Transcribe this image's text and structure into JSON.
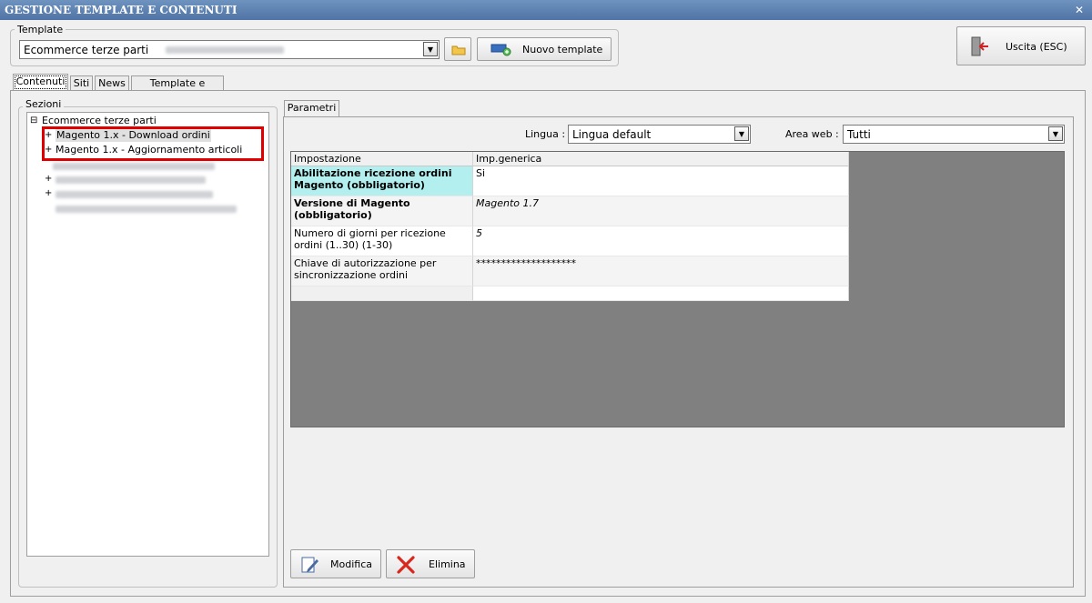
{
  "window": {
    "title": "GESTIONE TEMPLATE E CONTENUTI"
  },
  "template_group": {
    "label": "Template",
    "selected": "Ecommerce terze parti",
    "new_button": "Nuovo template"
  },
  "exit_button": {
    "label": "Uscita (ESC)"
  },
  "tabs": [
    {
      "label": "Contenuti"
    },
    {
      "label": "Siti"
    },
    {
      "label": "News"
    },
    {
      "label": "Template e plugins"
    }
  ],
  "sections": {
    "label": "Sezioni",
    "root": "Ecommerce terze parti",
    "items": [
      {
        "label": "Magento 1.x - Download ordini"
      },
      {
        "label": "Magento 1.x - Aggiornamento articoli"
      }
    ]
  },
  "params": {
    "tab": "Parametri",
    "lingua_label": "Lingua :",
    "lingua_value": "Lingua default",
    "area_label": "Area web :",
    "area_value": "Tutti",
    "headers": [
      "Impostazione",
      "Imp.generica"
    ],
    "rows": [
      {
        "setting": "Abilitazione ricezione ordini Magento (obbligatorio)",
        "value": "Si"
      },
      {
        "setting": "Versione di Magento (obbligatorio)",
        "value": "Magento 1.7"
      },
      {
        "setting": "Numero di giorni per ricezione ordini (1..30) (1-30)",
        "value": "5"
      },
      {
        "setting": "Chiave di autorizzazione per sincronizzazione ordini",
        "value": "********************"
      }
    ]
  },
  "actions": {
    "edit": "Modifica",
    "delete": "Elimina"
  },
  "colors": {
    "accent_title": "#4f74a5",
    "highlight_cell": "#b3efef",
    "grid_bg": "#808080",
    "annotation_red": "#e00000"
  }
}
